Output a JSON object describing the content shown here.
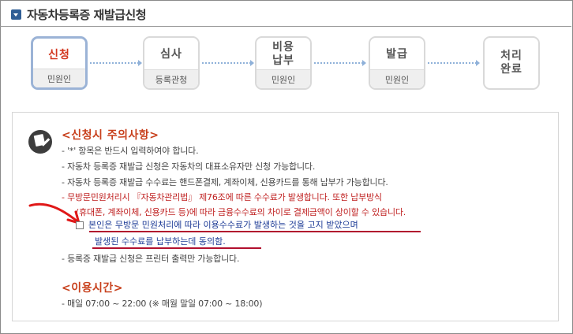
{
  "header": {
    "title": "자동차등록증 재발급신청"
  },
  "steps": [
    {
      "label": "신청",
      "sub": "민원인",
      "active": true
    },
    {
      "label": "심사",
      "sub": "등록관청"
    },
    {
      "label_line1": "비용",
      "label_line2": "납부",
      "sub": "민원인"
    },
    {
      "label": "발급",
      "sub": "민원인"
    },
    {
      "label_line1": "처리",
      "label_line2": "완료"
    }
  ],
  "notice": {
    "title": "<신청시 주의사항>",
    "lines": [
      "- '*' 항목은 반드시 입력하여야 합니다.",
      "- 자동차 등록증 재발급 신청은 자동차의 대표소유자만 신청 가능합니다.",
      "- 자동차 등록증 재발급 수수료는 핸드폰결제, 계좌이체, 신용카드를 통해 납부가 가능합니다.",
      "- 무방문민원처리시 『자동차관리법』 제76조에 따른 수수료가 발생합니다. 또한 납부방식",
      "(휴대폰, 계좌이체, 신용카드 등)에 따라 금융수수료의 차이로 결제금액이 상이할 수 있습니다.",
      "- 등록증 재발급 신청은 프린터 출력만 가능합니다."
    ],
    "agreement_line1": "본인은 무방문 민원처리에 따라 이용수수료가 발생하는 것을 고지 받았으며",
    "agreement_line2": "발생된 수수료를 납부하는데 동의함."
  },
  "hours": {
    "title": "<이용시간>",
    "text": "- 매일 07:00 ~ 22:00 (※ 매월 말일 07:00 ~ 18:00)"
  },
  "colors": {
    "accent": "#c8401c",
    "active_step_border": "#9bb3d6",
    "agreement_text": "#1d3b96",
    "underline": "#b10f2e"
  },
  "icons": {
    "header": "chevron-down-icon",
    "notice": "memo-pencil-icon",
    "annotation": "red-arrow-icon"
  }
}
